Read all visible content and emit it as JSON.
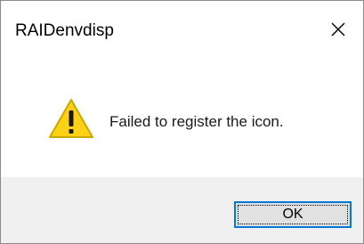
{
  "window": {
    "title": "RAIDenvdisp",
    "close_icon": "close-icon"
  },
  "message": {
    "icon": "warning-icon",
    "text": "Failed to register the icon."
  },
  "buttons": {
    "ok_label": "OK"
  },
  "colors": {
    "warning_fill": "#FCD116",
    "warning_stroke": "#C9A800",
    "focus_border": "#0078D7",
    "footer_bg": "#F0F0F0"
  }
}
